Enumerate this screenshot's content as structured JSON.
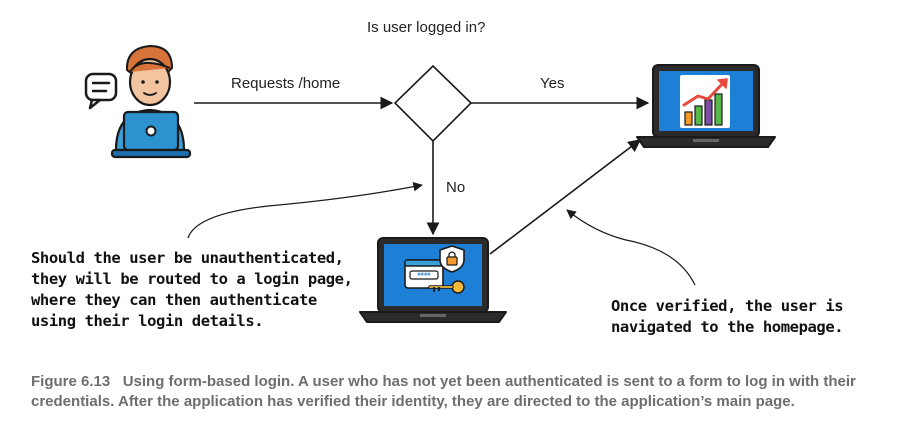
{
  "diagram": {
    "decision_label": "Is user logged in?",
    "request_label": "Requests /home",
    "yes_label": "Yes",
    "no_label": "No",
    "note_unauthenticated": [
      "Should the user be unauthenticated,",
      "they will be routed to a login page,",
      "where they can then authenticate",
      "using their login details."
    ],
    "note_verified": [
      "Once verified, the user is",
      "navigated to the homepage."
    ],
    "login_mask": "****"
  },
  "caption": {
    "number": "Figure 6.13",
    "text": "Using form-based login. A user who has not yet been authenticated is sent to a form to log in with their credentials. After the application has verified their identity, they are directed to the application’s main page."
  },
  "colors": {
    "line": "#1a1a1a",
    "laptop_screen": "#1e7fd6",
    "laptop_frame": "#2b2b2b",
    "chart_bars": [
      "#f29b2c",
      "#58b848",
      "#7b4fa3",
      "#e84a3c"
    ],
    "caption": "#6e6e6e"
  }
}
